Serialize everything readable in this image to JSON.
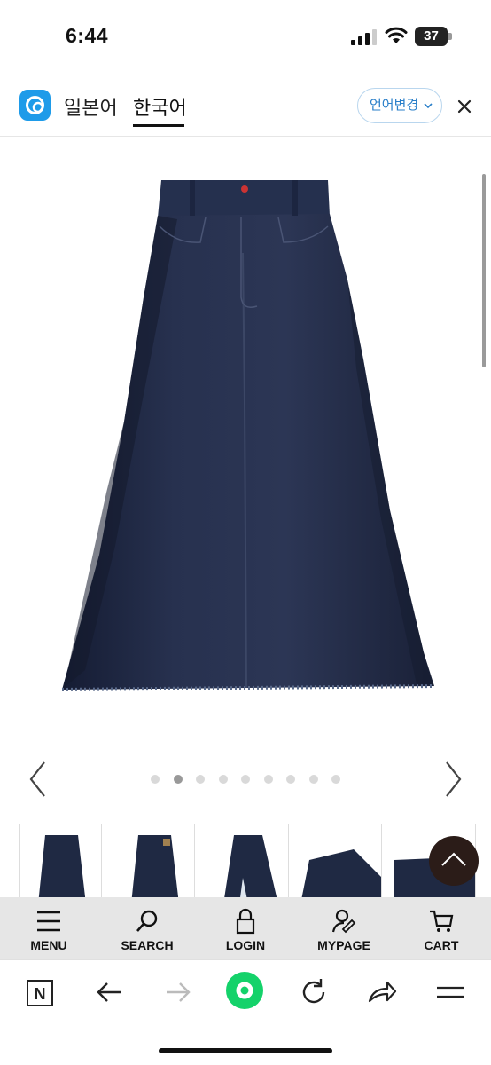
{
  "status_bar": {
    "time": "6:44",
    "battery": "37"
  },
  "translate_bar": {
    "tab_japanese": "일본어",
    "tab_korean": "한국어",
    "lang_change": "언어변경"
  },
  "carousel": {
    "dot_count": 9,
    "active_dot": 2
  },
  "site_nav": {
    "menu": "MENU",
    "search": "SEARCH",
    "login": "LOGIN",
    "mypage": "MYPAGE",
    "cart": "CART"
  },
  "browser_bar": {
    "tab_icon_label": "N"
  }
}
